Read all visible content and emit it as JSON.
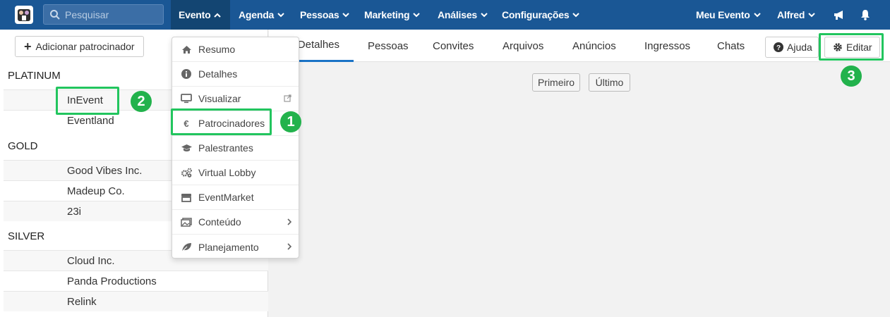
{
  "topbar": {
    "search_placeholder": "Pesquisar",
    "nav": [
      "Evento",
      "Agenda",
      "Pessoas",
      "Marketing",
      "Análises",
      "Configurações"
    ],
    "right": [
      "Meu Evento",
      "Alfred"
    ]
  },
  "sidebar": {
    "add_button": "Adicionar patrocinador",
    "tiers": [
      {
        "name": "PLATINUM",
        "sponsors": [
          "InEvent",
          "Eventland"
        ]
      },
      {
        "name": "GOLD",
        "sponsors": [
          "Good Vibes Inc.",
          "Madeup Co.",
          "23i"
        ]
      },
      {
        "name": "SILVER",
        "sponsors": [
          "Cloud Inc.",
          "Panda Productions",
          "Relink"
        ]
      }
    ]
  },
  "tabs": [
    "Detalhes",
    "Pessoas",
    "Convites",
    "Arquivos",
    "Anúncios",
    "Ingressos",
    "Chats"
  ],
  "buttons": {
    "help": "Ajuda",
    "edit": "Editar"
  },
  "pager": {
    "first": "Primeiro",
    "last": "Último"
  },
  "menu": [
    {
      "label": "Resumo",
      "icon": "home-icon"
    },
    {
      "label": "Detalhes",
      "icon": "info-icon"
    },
    {
      "label": "Visualizar",
      "icon": "monitor-icon",
      "tail": "external-link-icon"
    },
    {
      "label": "Patrocinadores",
      "icon": "euro-icon"
    },
    {
      "label": "Palestrantes",
      "icon": "graduation-cap-icon"
    },
    {
      "label": "Virtual Lobby",
      "icon": "gears-icon"
    },
    {
      "label": "EventMarket",
      "icon": "store-icon"
    },
    {
      "label": "Conteúdo",
      "icon": "images-icon",
      "tail": "chevron-right-icon"
    },
    {
      "label": "Planejamento",
      "icon": "leaf-icon",
      "tail": "chevron-right-icon"
    }
  ],
  "annotations": [
    "1",
    "2",
    "3"
  ],
  "colors": {
    "nav_bg": "#1a5795",
    "nav_active": "#134572",
    "highlight": "#22c55e",
    "tab_active": "#1a73c6"
  }
}
